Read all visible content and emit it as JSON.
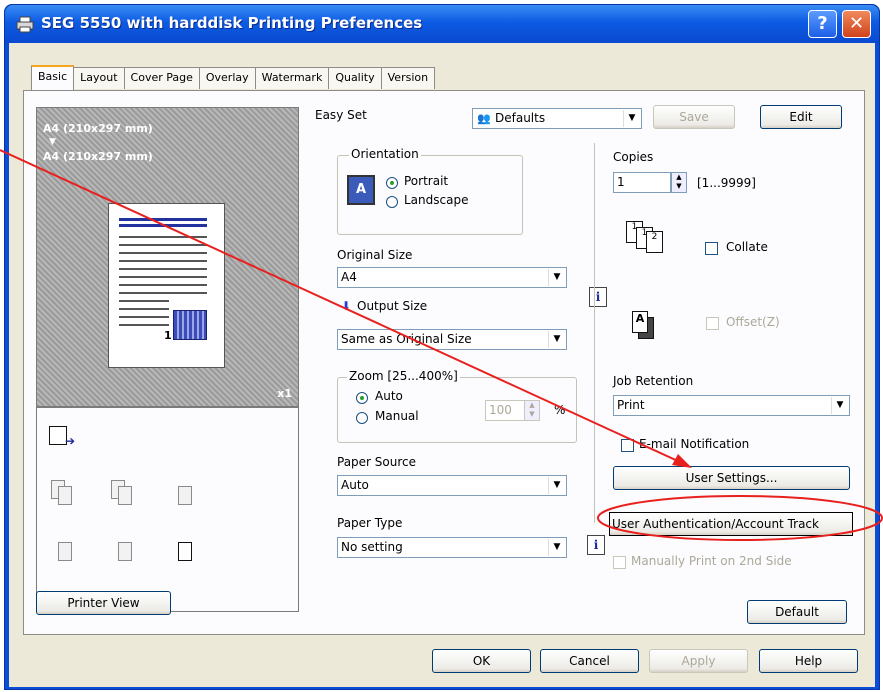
{
  "window": {
    "title": "SEG 5550 with harddisk Printing Preferences",
    "help_glyph": "?",
    "close_glyph": "✕"
  },
  "tabs": [
    "Basic",
    "Layout",
    "Cover Page",
    "Overlay",
    "Watermark",
    "Quality",
    "Version"
  ],
  "preview": {
    "original_label": "A4 (210x297 mm)",
    "arrow_glyph": "▼",
    "output_label": "A4 (210x297 mm)",
    "page_number": "1",
    "copies_label": "x1"
  },
  "printer_view_button": "Printer View",
  "easy_set": {
    "label": "Easy Set",
    "value": "Defaults",
    "save_button": "Save",
    "edit_button": "Edit"
  },
  "orientation": {
    "group_label": "Orientation",
    "portrait": "Portrait",
    "landscape": "Landscape",
    "selected": "Portrait"
  },
  "original_size": {
    "label": "Original Size",
    "value": "A4"
  },
  "output_size": {
    "label": "Output Size",
    "value": "Same as Original Size"
  },
  "zoom": {
    "group_label": "Zoom [25...400%]",
    "auto": "Auto",
    "manual": "Manual",
    "value": "100",
    "unit": "%",
    "selected": "Auto"
  },
  "paper_source": {
    "label": "Paper Source",
    "value": "Auto"
  },
  "paper_type": {
    "label": "Paper Type",
    "value": "No setting"
  },
  "copies": {
    "label": "Copies",
    "value": "1",
    "range": "[1...9999]"
  },
  "collate": {
    "label": "Collate",
    "checked": false
  },
  "offset": {
    "label": "Offset(Z)",
    "checked": false,
    "enabled": false
  },
  "job_retention": {
    "label": "Job Retention",
    "value": "Print"
  },
  "email_notification": {
    "label": "E-mail Notification",
    "checked": false
  },
  "user_settings_button": "User Settings...",
  "user_auth_button": "User Authentication/Account Track",
  "manual_second_side": {
    "label": "Manually Print on 2nd Side",
    "enabled": false
  },
  "info_glyph": "i",
  "default_button": "Default",
  "dialog_buttons": {
    "ok": "OK",
    "cancel": "Cancel",
    "apply": "Apply",
    "help": "Help"
  },
  "colors": {
    "titlebar": "#0a4ed8",
    "dialog_face": "#ece9d8",
    "annotation_red": "#e8201e",
    "active_tab_accent": "#f7a421"
  }
}
